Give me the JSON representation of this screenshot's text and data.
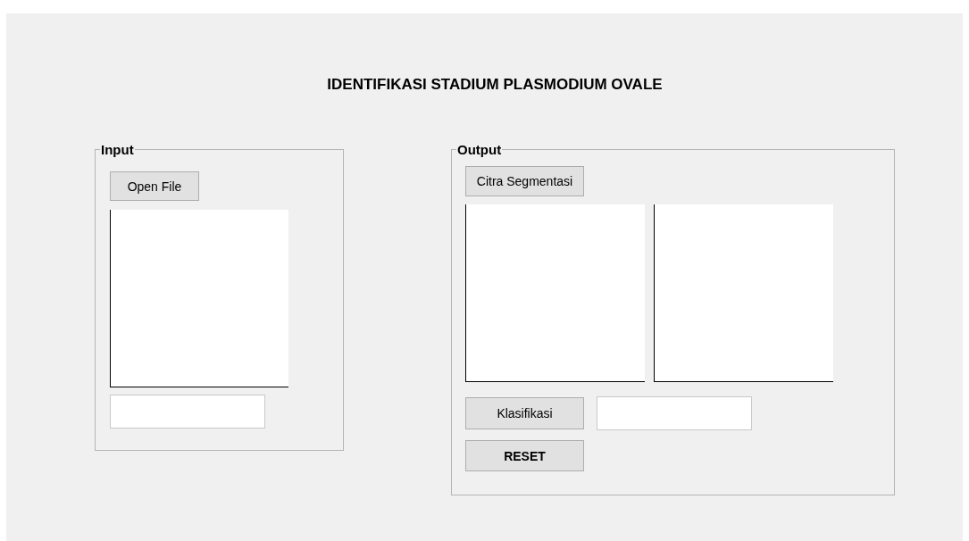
{
  "title": "IDENTIFIKASI STADIUM PLASMODIUM OVALE",
  "input_panel": {
    "legend": "Input",
    "button": "Open File"
  },
  "output_panel": {
    "legend": "Output",
    "segment_button": "Citra Segmentasi",
    "classify_button": "Klasifikasi",
    "reset_button": "RESET"
  }
}
